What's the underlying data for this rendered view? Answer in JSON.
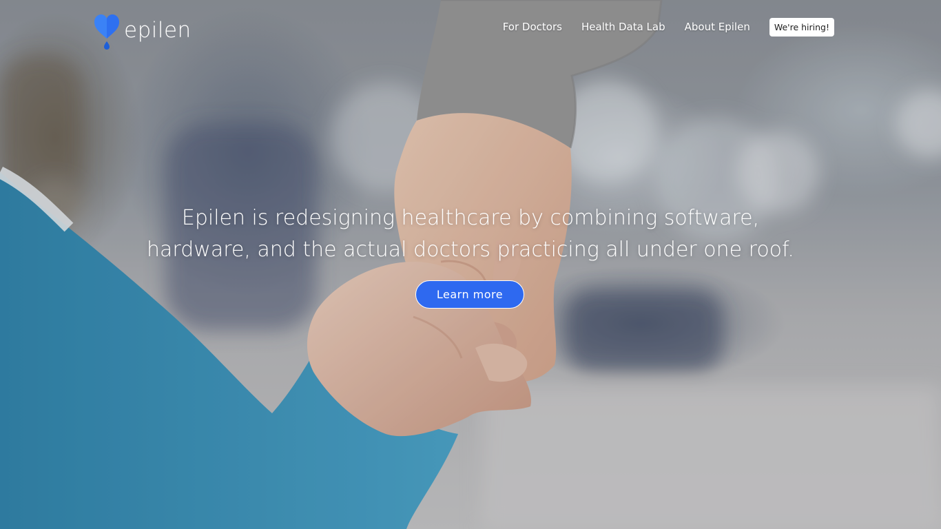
{
  "brand": {
    "name": "epilen",
    "logo_color": "#3b82f6",
    "logo_accent": "#1d5fd8"
  },
  "nav": {
    "items": [
      {
        "label": "For Doctors"
      },
      {
        "label": "Health Data Lab"
      },
      {
        "label": "About Epilen"
      }
    ],
    "hiring_label": "We're hiring!"
  },
  "hero": {
    "headline_line1": "Epilen is redesigning healthcare by combining software,",
    "headline_line2": "hardware, and the actual doctors practicing all under one roof.",
    "cta_label": "Learn more",
    "cta_color": "#2e69f0",
    "background_image": "photo-hands-holding"
  }
}
